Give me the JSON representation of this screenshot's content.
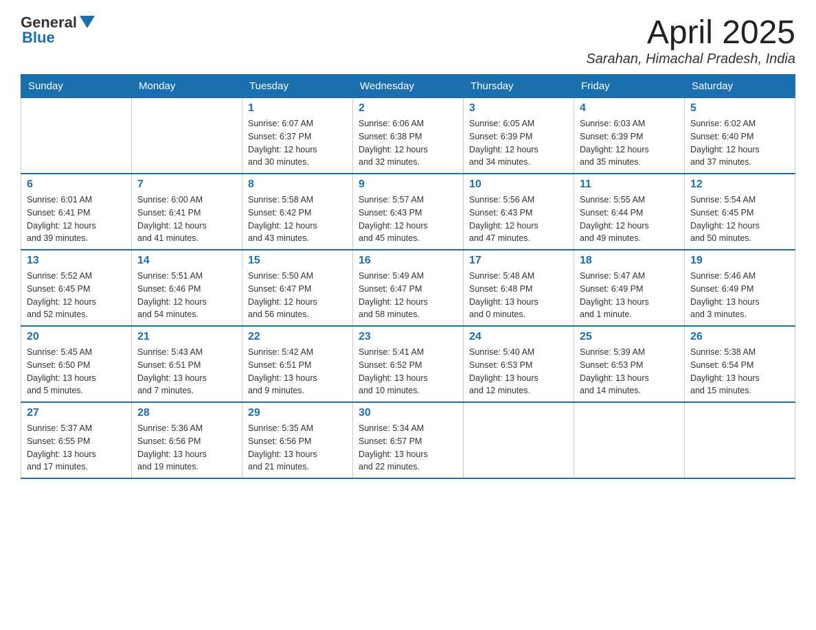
{
  "header": {
    "logo_general": "General",
    "logo_blue": "Blue",
    "month_title": "April 2025",
    "location": "Sarahan, Himachal Pradesh, India"
  },
  "weekdays": [
    "Sunday",
    "Monday",
    "Tuesday",
    "Wednesday",
    "Thursday",
    "Friday",
    "Saturday"
  ],
  "weeks": [
    [
      {
        "day": "",
        "detail": ""
      },
      {
        "day": "",
        "detail": ""
      },
      {
        "day": "1",
        "detail": "Sunrise: 6:07 AM\nSunset: 6:37 PM\nDaylight: 12 hours\nand 30 minutes."
      },
      {
        "day": "2",
        "detail": "Sunrise: 6:06 AM\nSunset: 6:38 PM\nDaylight: 12 hours\nand 32 minutes."
      },
      {
        "day": "3",
        "detail": "Sunrise: 6:05 AM\nSunset: 6:39 PM\nDaylight: 12 hours\nand 34 minutes."
      },
      {
        "day": "4",
        "detail": "Sunrise: 6:03 AM\nSunset: 6:39 PM\nDaylight: 12 hours\nand 35 minutes."
      },
      {
        "day": "5",
        "detail": "Sunrise: 6:02 AM\nSunset: 6:40 PM\nDaylight: 12 hours\nand 37 minutes."
      }
    ],
    [
      {
        "day": "6",
        "detail": "Sunrise: 6:01 AM\nSunset: 6:41 PM\nDaylight: 12 hours\nand 39 minutes."
      },
      {
        "day": "7",
        "detail": "Sunrise: 6:00 AM\nSunset: 6:41 PM\nDaylight: 12 hours\nand 41 minutes."
      },
      {
        "day": "8",
        "detail": "Sunrise: 5:58 AM\nSunset: 6:42 PM\nDaylight: 12 hours\nand 43 minutes."
      },
      {
        "day": "9",
        "detail": "Sunrise: 5:57 AM\nSunset: 6:43 PM\nDaylight: 12 hours\nand 45 minutes."
      },
      {
        "day": "10",
        "detail": "Sunrise: 5:56 AM\nSunset: 6:43 PM\nDaylight: 12 hours\nand 47 minutes."
      },
      {
        "day": "11",
        "detail": "Sunrise: 5:55 AM\nSunset: 6:44 PM\nDaylight: 12 hours\nand 49 minutes."
      },
      {
        "day": "12",
        "detail": "Sunrise: 5:54 AM\nSunset: 6:45 PM\nDaylight: 12 hours\nand 50 minutes."
      }
    ],
    [
      {
        "day": "13",
        "detail": "Sunrise: 5:52 AM\nSunset: 6:45 PM\nDaylight: 12 hours\nand 52 minutes."
      },
      {
        "day": "14",
        "detail": "Sunrise: 5:51 AM\nSunset: 6:46 PM\nDaylight: 12 hours\nand 54 minutes."
      },
      {
        "day": "15",
        "detail": "Sunrise: 5:50 AM\nSunset: 6:47 PM\nDaylight: 12 hours\nand 56 minutes."
      },
      {
        "day": "16",
        "detail": "Sunrise: 5:49 AM\nSunset: 6:47 PM\nDaylight: 12 hours\nand 58 minutes."
      },
      {
        "day": "17",
        "detail": "Sunrise: 5:48 AM\nSunset: 6:48 PM\nDaylight: 13 hours\nand 0 minutes."
      },
      {
        "day": "18",
        "detail": "Sunrise: 5:47 AM\nSunset: 6:49 PM\nDaylight: 13 hours\nand 1 minute."
      },
      {
        "day": "19",
        "detail": "Sunrise: 5:46 AM\nSunset: 6:49 PM\nDaylight: 13 hours\nand 3 minutes."
      }
    ],
    [
      {
        "day": "20",
        "detail": "Sunrise: 5:45 AM\nSunset: 6:50 PM\nDaylight: 13 hours\nand 5 minutes."
      },
      {
        "day": "21",
        "detail": "Sunrise: 5:43 AM\nSunset: 6:51 PM\nDaylight: 13 hours\nand 7 minutes."
      },
      {
        "day": "22",
        "detail": "Sunrise: 5:42 AM\nSunset: 6:51 PM\nDaylight: 13 hours\nand 9 minutes."
      },
      {
        "day": "23",
        "detail": "Sunrise: 5:41 AM\nSunset: 6:52 PM\nDaylight: 13 hours\nand 10 minutes."
      },
      {
        "day": "24",
        "detail": "Sunrise: 5:40 AM\nSunset: 6:53 PM\nDaylight: 13 hours\nand 12 minutes."
      },
      {
        "day": "25",
        "detail": "Sunrise: 5:39 AM\nSunset: 6:53 PM\nDaylight: 13 hours\nand 14 minutes."
      },
      {
        "day": "26",
        "detail": "Sunrise: 5:38 AM\nSunset: 6:54 PM\nDaylight: 13 hours\nand 15 minutes."
      }
    ],
    [
      {
        "day": "27",
        "detail": "Sunrise: 5:37 AM\nSunset: 6:55 PM\nDaylight: 13 hours\nand 17 minutes."
      },
      {
        "day": "28",
        "detail": "Sunrise: 5:36 AM\nSunset: 6:56 PM\nDaylight: 13 hours\nand 19 minutes."
      },
      {
        "day": "29",
        "detail": "Sunrise: 5:35 AM\nSunset: 6:56 PM\nDaylight: 13 hours\nand 21 minutes."
      },
      {
        "day": "30",
        "detail": "Sunrise: 5:34 AM\nSunset: 6:57 PM\nDaylight: 13 hours\nand 22 minutes."
      },
      {
        "day": "",
        "detail": ""
      },
      {
        "day": "",
        "detail": ""
      },
      {
        "day": "",
        "detail": ""
      }
    ]
  ]
}
